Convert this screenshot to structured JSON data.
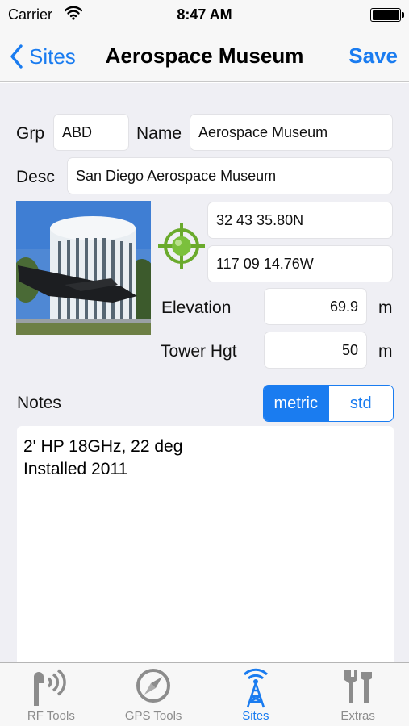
{
  "status": {
    "carrier": "Carrier",
    "time": "8:47 AM",
    "battery_level": 1.0
  },
  "nav": {
    "back_label": "Sites",
    "title": "Aerospace Museum",
    "save_label": "Save"
  },
  "form": {
    "group_label": "Grp",
    "group_value": "ABD",
    "name_label": "Name",
    "name_value": "Aerospace Museum",
    "desc_label": "Desc",
    "desc_value": "San Diego Aerospace Museum",
    "latitude": "32 43 35.80N",
    "longitude": "117 09 14.76W",
    "elevation_label": "Elevation",
    "elevation_value": "69.9",
    "elevation_unit": "m",
    "tower_label": "Tower Hgt",
    "tower_value": "50",
    "tower_unit": "m",
    "notes_label": "Notes",
    "notes_value": "2' HP 18GHz, 22 deg\nInstalled 2011"
  },
  "units": {
    "options": [
      "metric",
      "std"
    ],
    "selected": "metric"
  },
  "tabs": [
    {
      "label": "RF Tools",
      "icon": "rf-tools-icon"
    },
    {
      "label": "GPS Tools",
      "icon": "compass-icon"
    },
    {
      "label": "Sites",
      "icon": "radio-tower-icon",
      "active": true
    },
    {
      "label": "Extras",
      "icon": "tools-icon"
    }
  ],
  "colors": {
    "accent": "#1a7cf0",
    "target_green": "#6aaa2c",
    "tab_inactive": "#8c8c8c",
    "background": "#efeff4"
  }
}
